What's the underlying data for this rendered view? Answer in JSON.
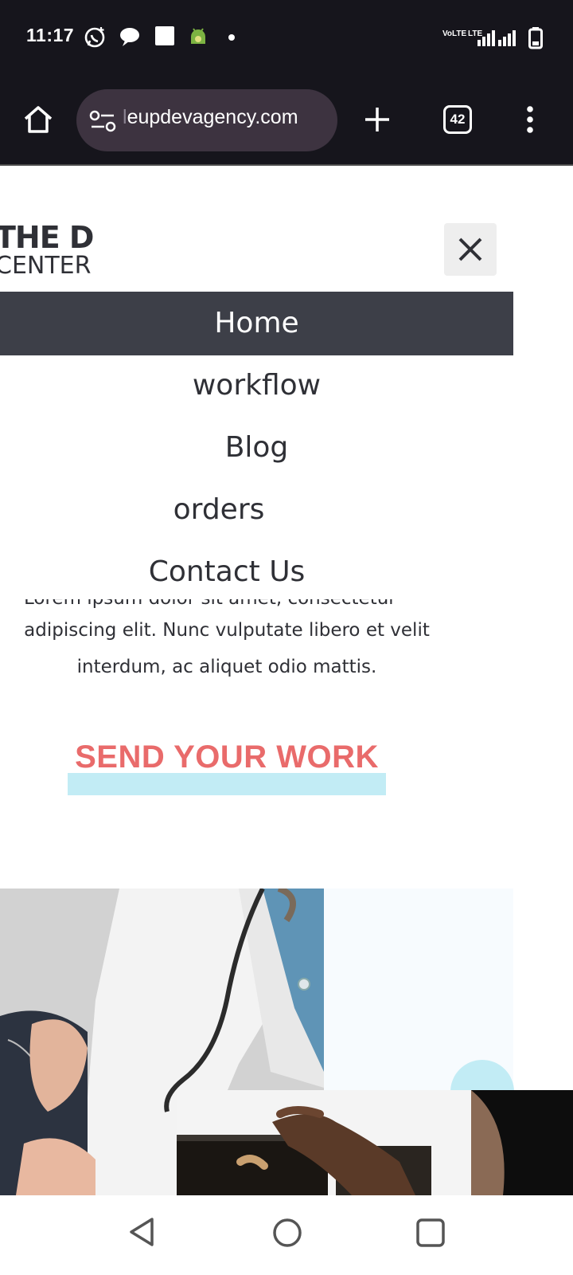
{
  "status_bar": {
    "time": "11:17",
    "network_label_1": "VoLTE",
    "network_label_2": "LTE",
    "icons": [
      "whatsapp-icon",
      "chat-bubble-icon",
      "square-notification-icon",
      "android-debug-icon",
      "dot-icon",
      "signal-icon",
      "battery-icon"
    ]
  },
  "browser": {
    "url_faded": "l",
    "url_visible": "eupdevagency.com",
    "tab_count": "42",
    "icons": [
      "home-icon",
      "site-info-icon",
      "plus-icon",
      "tabs-icon",
      "more-vert-icon"
    ]
  },
  "site": {
    "logo_line1": "THE D",
    "logo_line2": "CENTER",
    "nav_items": [
      {
        "label": "Home"
      },
      {
        "label": "workflow"
      },
      {
        "label": "Blog"
      },
      {
        "label": "orders"
      },
      {
        "label": "Contact Us"
      }
    ],
    "intro_cut": "Lorem ipsum dolor sit amet, consectetur",
    "intro_line2": "adipiscing elit. Nunc vulputate libero et velit",
    "intro_line3": "interdum, ac aliquet odio mattis.",
    "cta": "SEND YOUR WORK",
    "colors": {
      "cta": "#e96b6b",
      "highlight": "#c2ecf5",
      "active_nav": "#3d3f48"
    }
  },
  "system_nav": {
    "icons": [
      "back-icon",
      "home-circle-icon",
      "recents-icon"
    ]
  }
}
